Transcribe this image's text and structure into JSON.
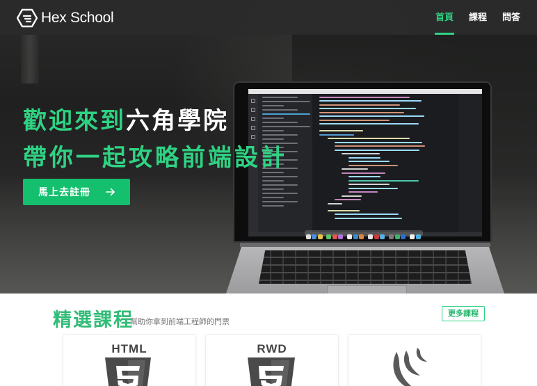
{
  "brand": {
    "name": "Hex School",
    "accent": "#2fd283",
    "button_green": "#14bf6d",
    "logo_icon": "hexagon-logo-icon"
  },
  "nav": {
    "items": [
      {
        "label": "首頁",
        "active": true
      },
      {
        "label": "課程",
        "active": false
      },
      {
        "label": "問答",
        "active": false
      }
    ]
  },
  "hero": {
    "title_green": "歡迎來到",
    "title_white": "六角學院",
    "subtitle": "帶你一起攻略前端設計",
    "cta_label": "馬上去註冊",
    "cta_icon": "arrow-right-icon",
    "background": "laptop-with-code-editor-photo"
  },
  "courses": {
    "title": "精選課程",
    "subtitle": "幫助你拿到前端工程師的門票",
    "more_label": "更多課程",
    "cards": [
      {
        "label": "HTML",
        "icon": "html5-shield-icon"
      },
      {
        "label": "RWD",
        "icon": "css3-shield-icon"
      },
      {
        "label": "",
        "icon": "jquery-logo-icon"
      }
    ]
  }
}
